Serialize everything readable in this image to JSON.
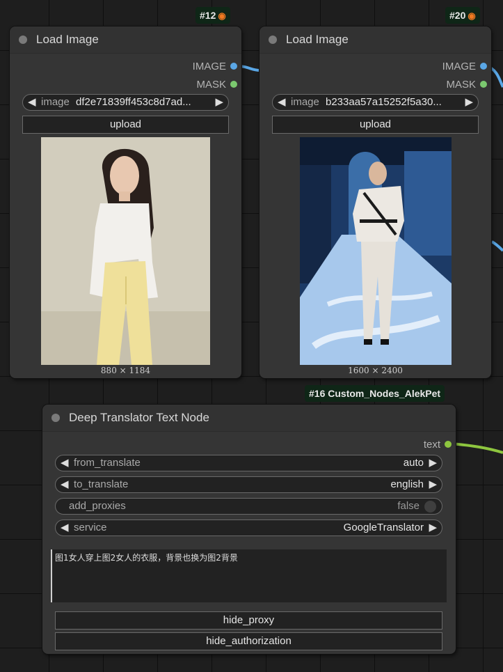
{
  "nodes": [
    {
      "badge": "#12",
      "title": "Load Image",
      "outputs": [
        "IMAGE",
        "MASK"
      ],
      "image_widget": {
        "label": "image",
        "value": "df2e71839ff453c8d7ad..."
      },
      "upload_label": "upload",
      "image_size": "880 × 1184"
    },
    {
      "badge": "#20",
      "title": "Load Image",
      "outputs": [
        "IMAGE",
        "MASK"
      ],
      "image_widget": {
        "label": "image",
        "value": "b233aa57a15252f5a30..."
      },
      "upload_label": "upload",
      "image_size": "1600 × 2400"
    }
  ],
  "translator": {
    "badge": "#16 Custom_Nodes_AlekPet",
    "title": "Deep Translator Text Node",
    "output": "text",
    "widgets": [
      {
        "label": "from_translate",
        "value": "auto"
      },
      {
        "label": "to_translate",
        "value": "english"
      },
      {
        "label": "add_proxies",
        "value": "false"
      },
      {
        "label": "service",
        "value": "GoogleTranslator"
      }
    ],
    "text": "图1女人穿上图2女人的衣服，背景也换为图2背景",
    "buttons": [
      "hide_proxy",
      "hide_authorization"
    ]
  },
  "colors": {
    "image_port": "#5aa7e6",
    "mask_port": "#7bc96f",
    "text_port": "#8ec63f",
    "badge_bg": "#0f2617"
  },
  "icons": [
    "fox-icon",
    "arrow-left-icon",
    "arrow-right-icon",
    "toggle-icon"
  ]
}
